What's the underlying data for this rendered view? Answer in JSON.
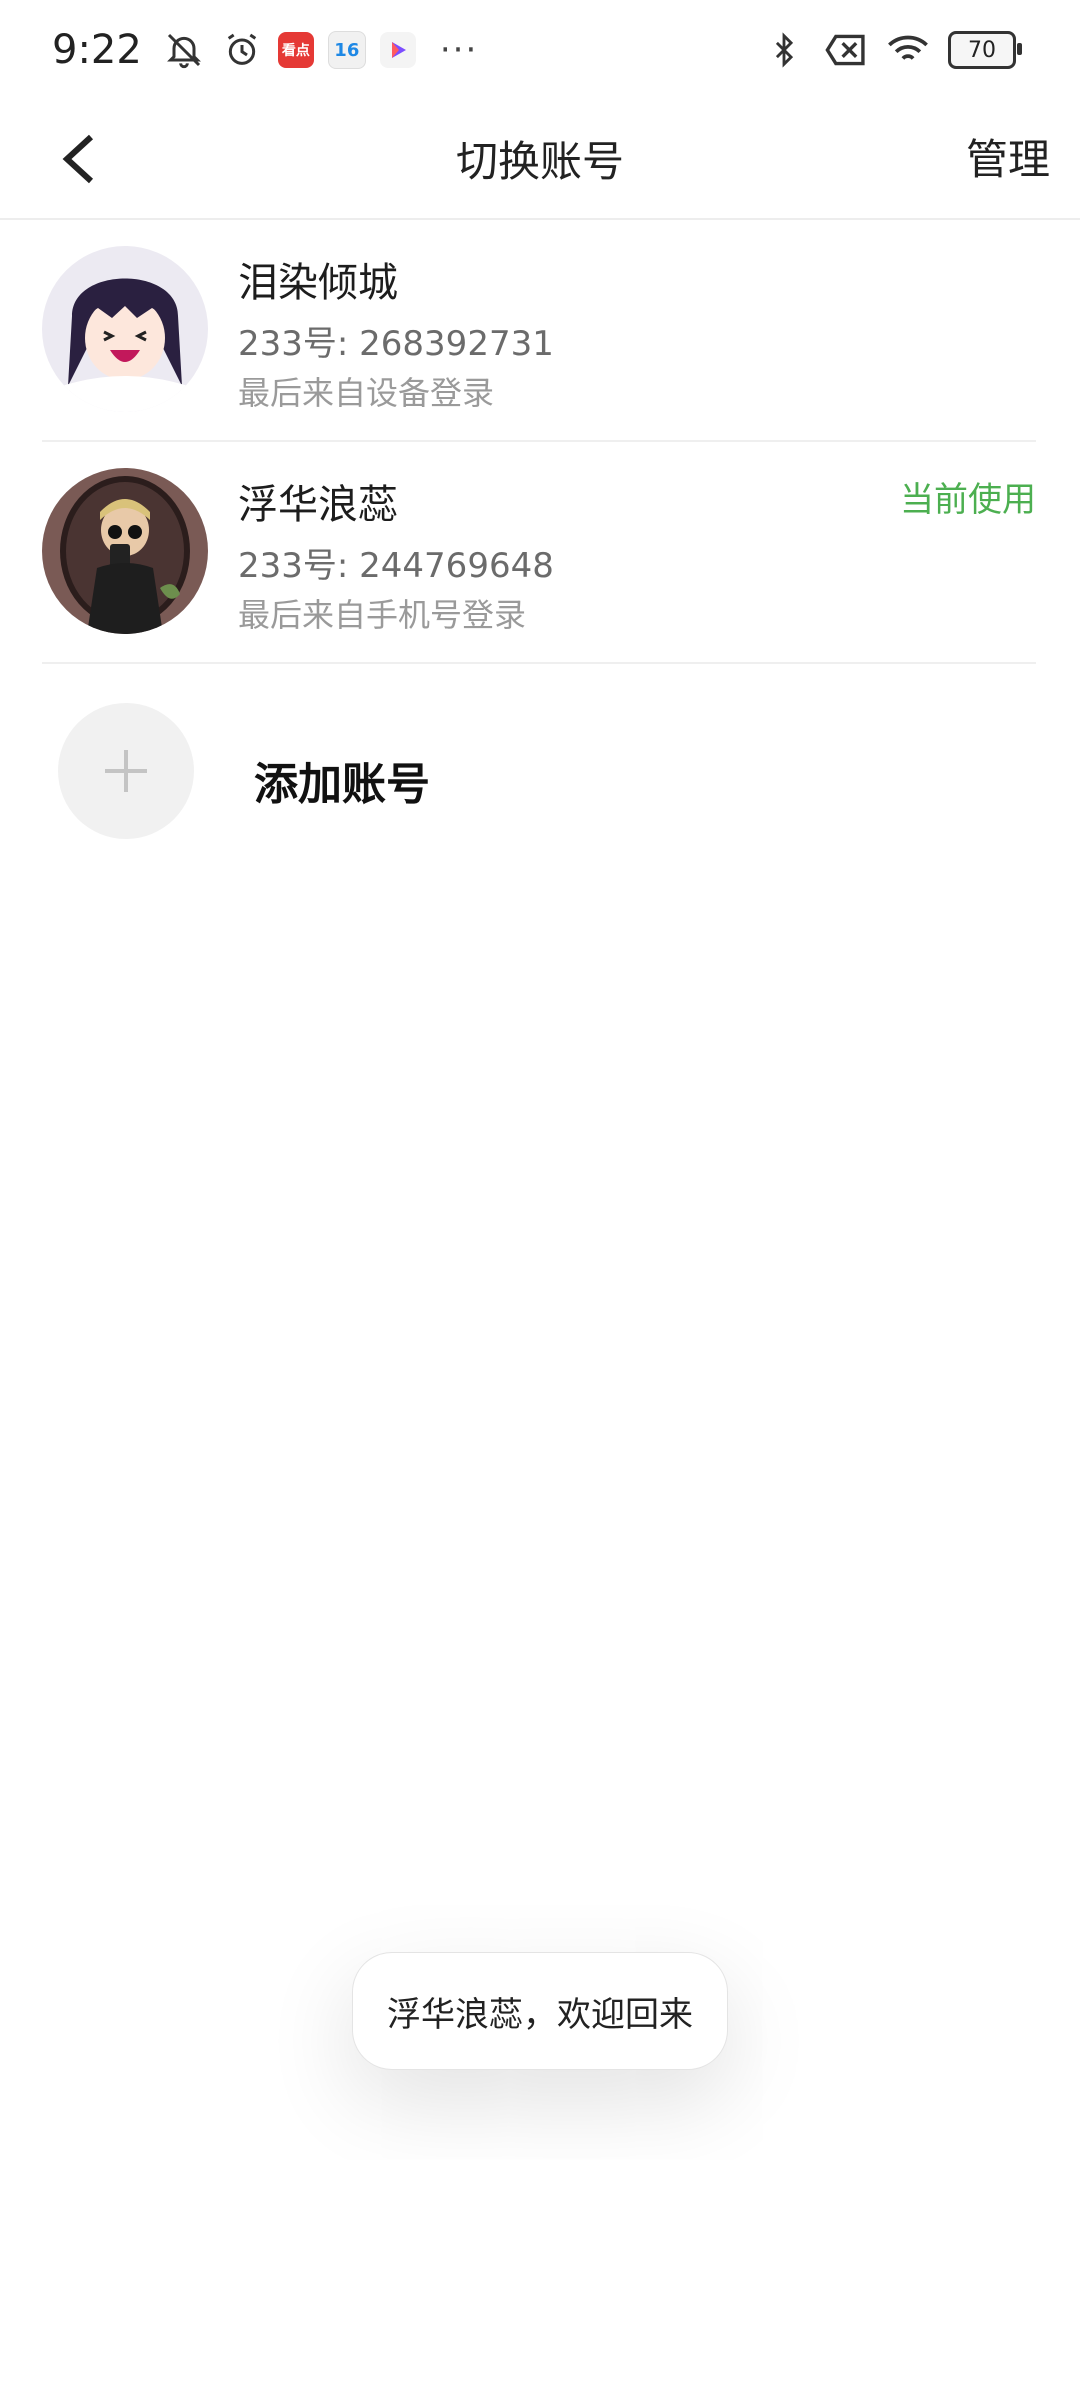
{
  "status_bar": {
    "time": "9:22",
    "app_badge_red": "看点",
    "app_badge_cal": "16",
    "more": "···",
    "battery": "70"
  },
  "header": {
    "title": "切换账号",
    "manage_label": "管理"
  },
  "accounts": [
    {
      "name": "泪染倾城",
      "id": "233号: 268392731",
      "login": "最后来自设备登录",
      "current": ""
    },
    {
      "name": "浮华浪蕊",
      "id": "233号: 244769648",
      "login": "最后来自手机号登录",
      "current": "当前使用"
    }
  ],
  "add_account": {
    "label": "添加账号"
  },
  "toast": {
    "text": "浮华浪蕊，欢迎回来"
  },
  "colors": {
    "accent_green": "#4caf50",
    "divider": "#efefef"
  }
}
